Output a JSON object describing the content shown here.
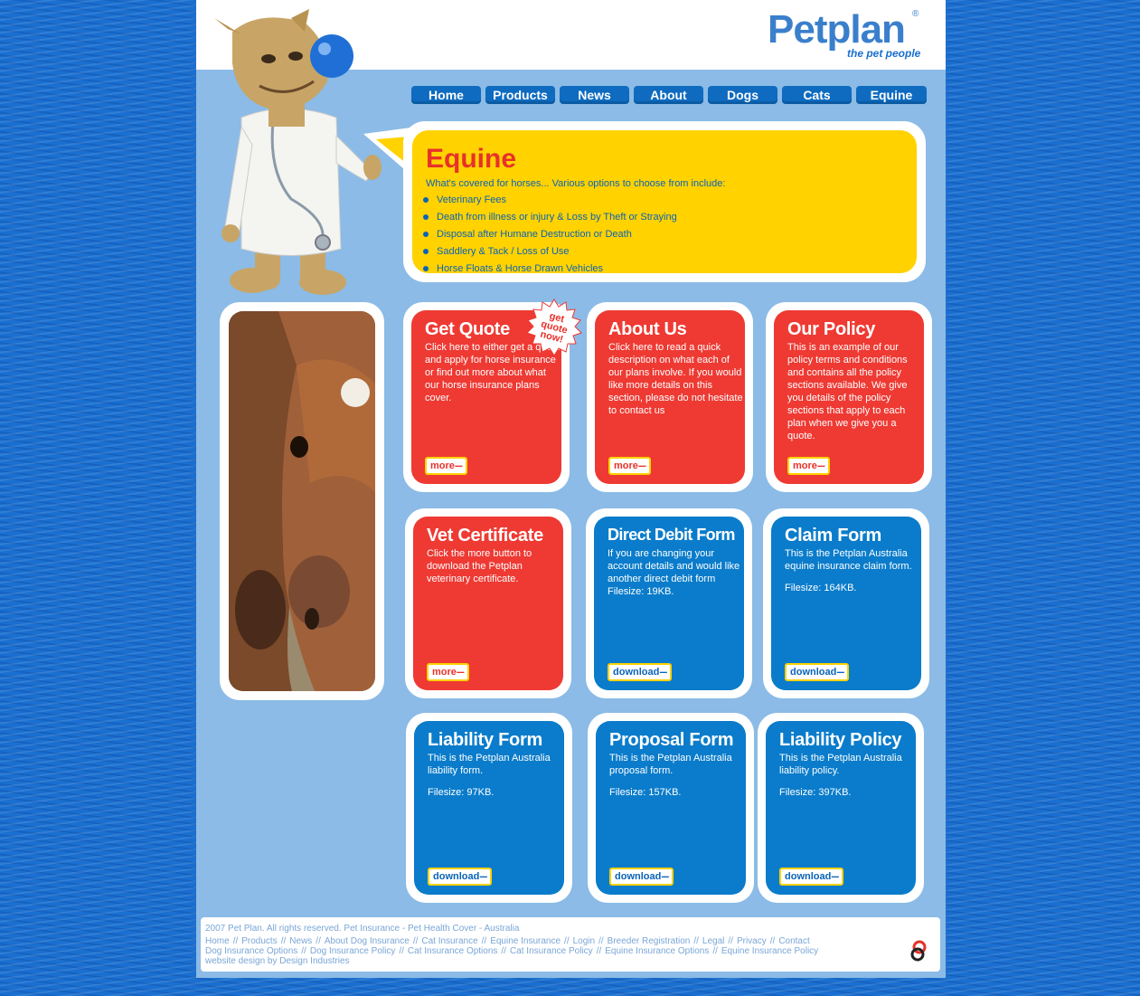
{
  "brand": {
    "name": "Petplan",
    "registered": "®",
    "tagline": "the pet people"
  },
  "nav": [
    "Home",
    "Products",
    "News",
    "About",
    "Dogs",
    "Cats",
    "Equine"
  ],
  "equine": {
    "title": "Equine",
    "intro": "What's covered for horses... Various options to choose from include:",
    "items": [
      "Veterinary Fees",
      "Death from illness or injury & Loss by Theft or Straying",
      "Disposal after Humane Destruction or Death",
      "Saddlery & Tack / Loss of Use",
      "Horse Floats & Horse Drawn Vehicles"
    ]
  },
  "badge": {
    "line1": "get",
    "line2": "quote",
    "line3": "now!"
  },
  "cards": [
    {
      "title": "Get Quote",
      "body": "Click here to either get a quote and apply for horse insurance or find out more about what our horse insurance plans cover.",
      "filesize": "",
      "button": "more"
    },
    {
      "title": "About Us",
      "body": "Click here to read a quick description on what each of our plans involve. If you would like more details on this section, please do not hesitate to contact us",
      "filesize": "",
      "button": "more"
    },
    {
      "title": "Our Policy",
      "body": "This is an example of our policy terms and conditions and contains all the policy sections available. We give you details of the policy sections that apply to each plan when we give you a quote.",
      "filesize": "",
      "button": "more"
    },
    {
      "title": "Vet Certificate",
      "body": "Click the more button to download the Petplan veterinary certificate.",
      "filesize": "",
      "button": "more"
    },
    {
      "title": "Direct Debit Form",
      "body": "If you are changing your account details and would like another direct debit form",
      "filesize": "Filesize: 19KB.",
      "button": "download"
    },
    {
      "title": "Claim Form",
      "body": "This is the Petplan Australia equine insurance claim form.",
      "filesize": "Filesize: 164KB.",
      "button": "download"
    },
    {
      "title": "Liability Form",
      "body": "This is the Petplan Australia liability form.",
      "filesize": "Filesize: 97KB.",
      "button": "download"
    },
    {
      "title": "Proposal Form",
      "body": "This is the Petplan Australia proposal form.",
      "filesize": "Filesize: 157KB.",
      "button": "download"
    },
    {
      "title": "Liability Policy",
      "body": "This is the Petplan Australia liability policy.",
      "filesize": "Filesize: 397KB.",
      "button": "download"
    }
  ],
  "button_suffix": "---",
  "footer": {
    "copyright": "2007 Pet Plan. All rights reserved. Pet Insurance - Pet Health Cover - Australia",
    "links_row1": [
      "Home",
      "Products",
      "News",
      "About Dog Insurance",
      "Cat Insurance",
      "Equine Insurance",
      "Login",
      "Breeder Registration",
      "Legal",
      "Privacy",
      "Contact"
    ],
    "links_row2": [
      "Dog Insurance Options",
      "Dog Insurance Policy",
      "Cat Insurance Options",
      "Cat Insurance Policy",
      "Equine Insurance Options",
      "Equine Insurance Policy"
    ],
    "separator": "//",
    "credit": "website design by Design Industries"
  },
  "colors": {
    "red": "#ee3a33",
    "blue": "#0a7ccb",
    "yellow": "#ffd200",
    "nav_blue": "#0e6bc0",
    "page_bg": "#8bbbe6"
  }
}
